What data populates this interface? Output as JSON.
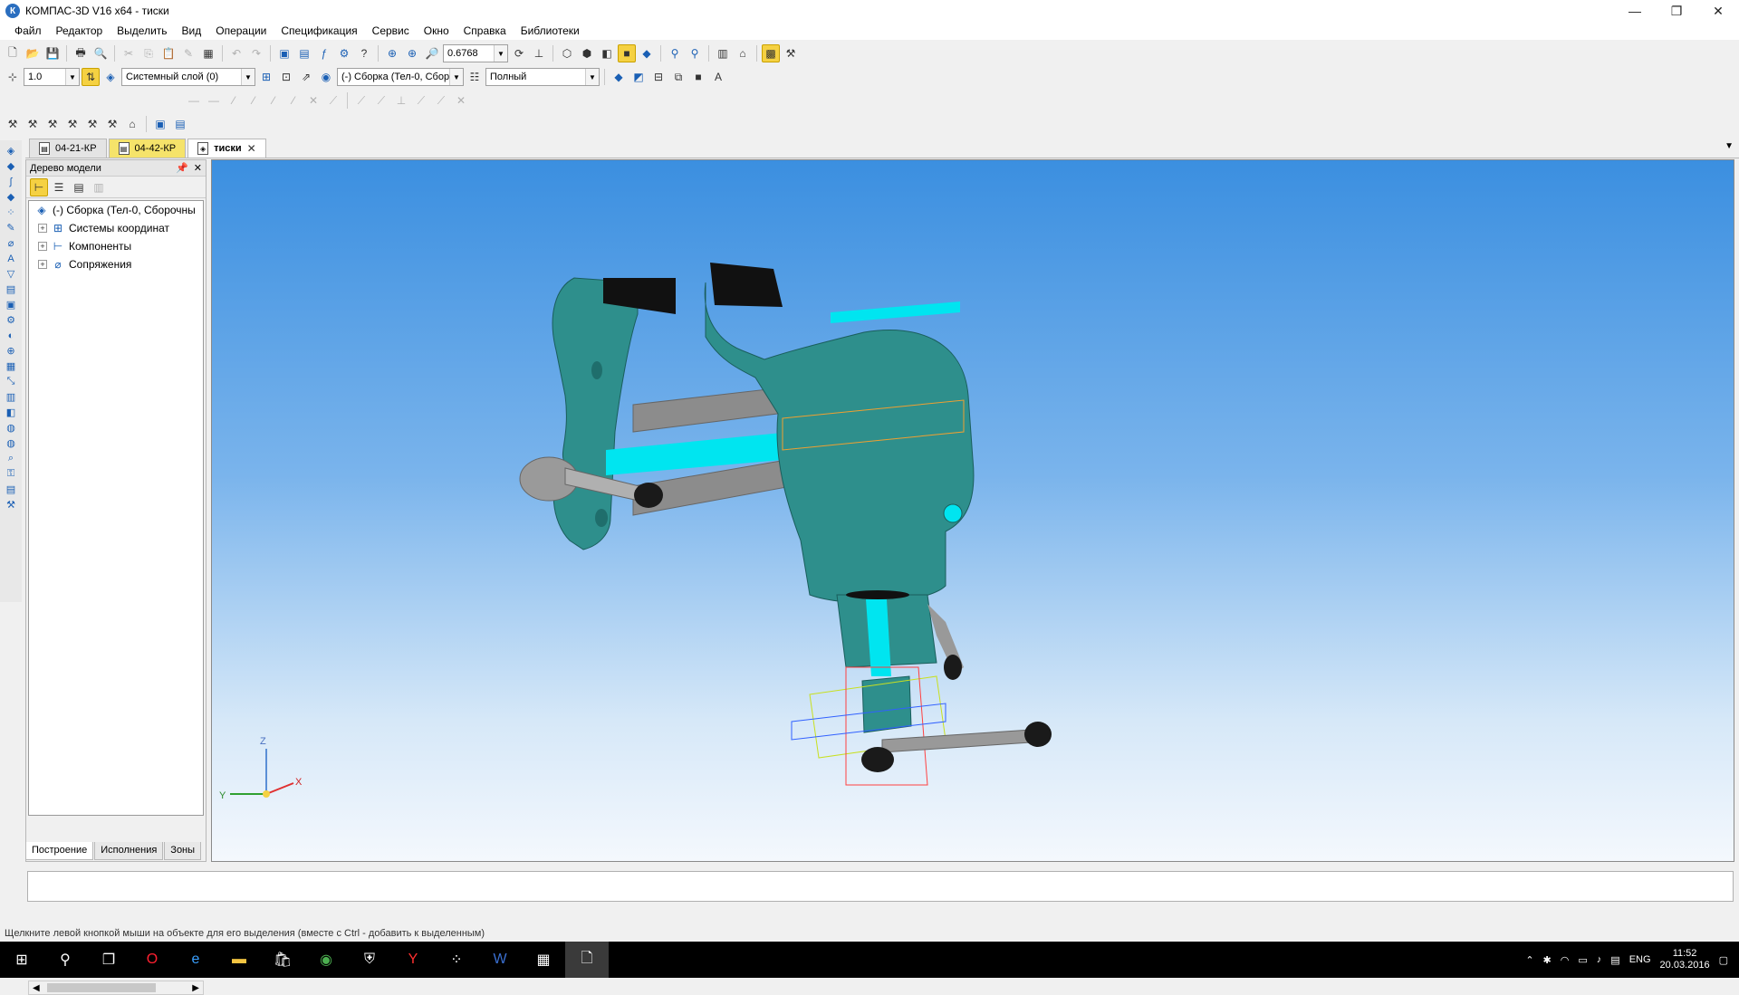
{
  "window": {
    "title": "КОМПАС-3D V16  x64 - тиски",
    "app_icon": "К"
  },
  "menu": [
    "Файл",
    "Редактор",
    "Выделить",
    "Вид",
    "Операции",
    "Спецификация",
    "Сервис",
    "Окно",
    "Справка",
    "Библиотеки"
  ],
  "toolbar": {
    "zoom_value": "0.6768",
    "step_value": "1.0",
    "layer_value": "Системный слой (0)",
    "assembly_value": "(-) Сборка (Тел-0, Сбор",
    "mode_value": "Полный"
  },
  "tabs": [
    {
      "label": "04-21-КР"
    },
    {
      "label": "04-42-КР"
    },
    {
      "label": "тиски"
    }
  ],
  "tree": {
    "title": "Дерево модели",
    "root": "(-) Сборка (Тел-0, Сборочны",
    "items": [
      "Системы координат",
      "Компоненты",
      "Сопряжения"
    ]
  },
  "tree_bottom_tabs": [
    "Построение",
    "Исполнения",
    "Зоны"
  ],
  "axes": {
    "z": "Z",
    "y": "Y",
    "x": "X"
  },
  "status": "Щелкните левой кнопкой мыши на объекте для его выделения (вместе с Ctrl - добавить к выделенным)",
  "taskbar": {
    "lang": "ENG",
    "time": "11:52",
    "date": "20.03.2016"
  },
  "colors": {
    "model": "#2e8f8c",
    "model_dark": "#1f6e6c",
    "cyan": "#00e5f0",
    "viewport_top": "#3b8fe0",
    "viewport_bottom": "#f4f8fd"
  }
}
